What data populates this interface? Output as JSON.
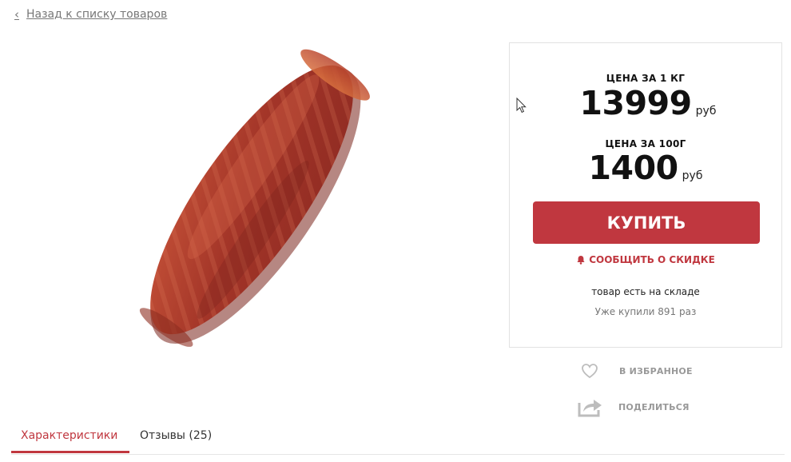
{
  "nav": {
    "back_label": "Назад к списку товаров"
  },
  "product": {
    "image_alt": "сыровяленая колбаса"
  },
  "price_box": {
    "per_kg_label": "ЦЕНА ЗА 1 КГ",
    "per_kg_value": "13999",
    "per_kg_unit": "руб",
    "per_100g_label": "ЦЕНА ЗА 100Г",
    "per_100g_value": "1400",
    "per_100g_unit": "руб",
    "buy_label": "КУПИТЬ",
    "discount_label": "СООБЩИТЬ О СКИДКЕ",
    "stock_text": "товар есть на складе",
    "bought_text": "Уже купили 891 раз"
  },
  "actions": {
    "favorite_label": "В ИЗБРАННОЕ",
    "share_label": "ПОДЕЛИТЬСЯ"
  },
  "tabs": [
    {
      "label": "Характеристики",
      "active": true
    },
    {
      "label": "Отзывы (25)",
      "active": false
    }
  ],
  "colors": {
    "accent": "#c0373f",
    "muted_text": "#999999",
    "border": "#e2e2e2"
  },
  "icons": [
    "chevron-left-icon",
    "bell-icon",
    "heart-icon",
    "share-icon",
    "mouse-cursor-icon"
  ]
}
